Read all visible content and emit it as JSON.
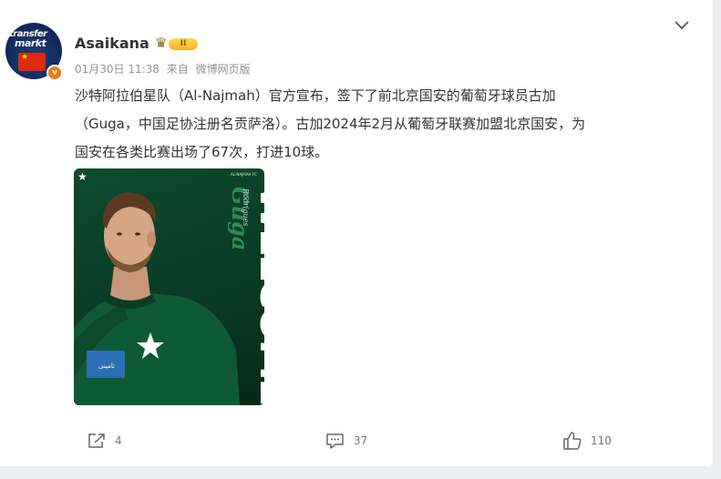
{
  "post": {
    "username": "Asaikana",
    "rank_label": "II",
    "avatar_text_line1": "transfer",
    "avatar_text_line2": "markt",
    "verified_mark": "v",
    "timestamp": "01月30日 11:38",
    "source_prefix": "来自",
    "source": "微博网页版",
    "text_lines": [
      "沙特阿拉伯星队（Al-Najmah）官方宣布，签下了前北京国安的葡萄牙球员古加",
      "（Guga，中国足协注册名贡萨洛）。古加2024年2月从葡萄牙联赛加盟北京国安，为",
      "国安在各类比赛出场了67次，打进10球。"
    ],
    "image": {
      "headline": "WELCOME",
      "player_name": "Guga",
      "player_surname": "Rodrigues",
      "sponsor": "تامينى",
      "club_tag": "AL-NAJMAH FC"
    }
  },
  "actions": {
    "share_count": "4",
    "comment_count": "37",
    "like_count": "110"
  },
  "colors": {
    "accent_orange": "#f07a12",
    "text_primary": "#333333",
    "text_meta": "#939393",
    "photo_green": "#0d4a2e"
  },
  "icons": {
    "menu": "chevron-down-icon",
    "share": "share-icon",
    "comment": "comment-icon",
    "like": "thumbs-up-icon",
    "rank": "crown-icon"
  }
}
